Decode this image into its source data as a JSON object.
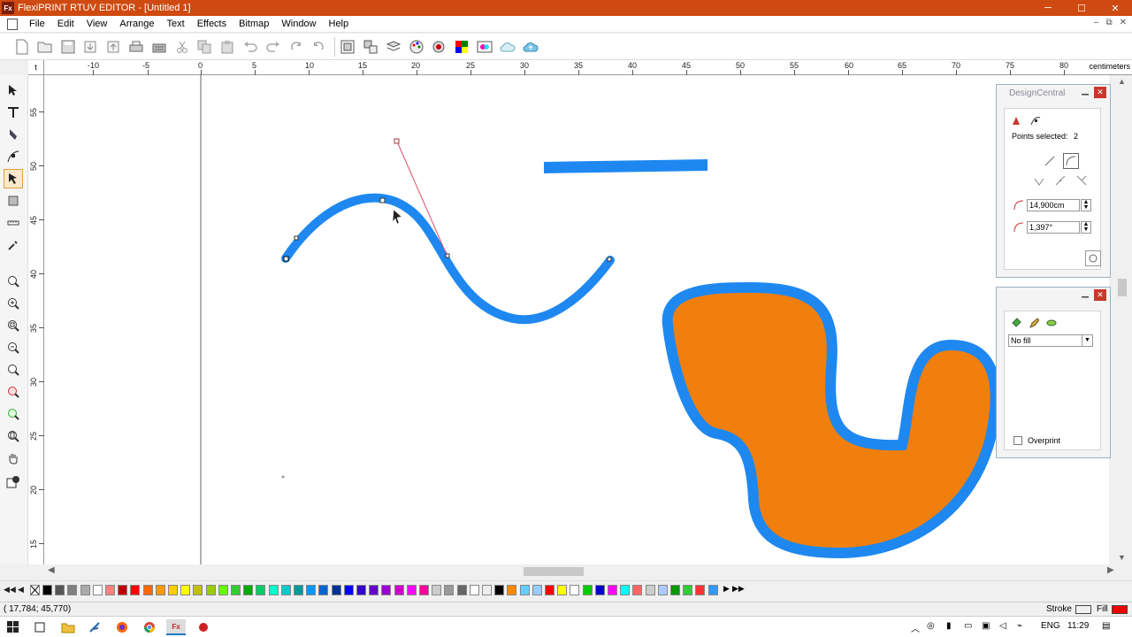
{
  "window": {
    "title": "FlexiPRINT RTUV EDITOR - [Untitled 1]",
    "app_icon": "Fx",
    "minimize": "─",
    "maximize": "☐",
    "close": "✕"
  },
  "menu": [
    "File",
    "Edit",
    "View",
    "Arrange",
    "Text",
    "Effects",
    "Bitmap",
    "Window",
    "Help"
  ],
  "mdi_controls": {
    "minimize": "–",
    "restore": "⧉",
    "close": "✕"
  },
  "toolbar_icons": [
    "new-icon",
    "open-icon",
    "save-icon",
    "import-icon",
    "export-icon",
    "print-icon",
    "print-cut-icon",
    "cut-icon",
    "copy-icon",
    "paste-icon",
    "undo-icon",
    "redo-icon",
    "repeat-icon",
    "redo-repeat-icon",
    "group-icon",
    "ungroup-icon",
    "layers-icon",
    "color-palette-icon",
    "color-picker-icon",
    "swatch-grid-icon",
    "color-manage-icon",
    "cloud-icon",
    "upload-icon"
  ],
  "ruler": {
    "unit": "centimeters",
    "h_ticks": [
      "-10",
      "-5",
      "0",
      "5",
      "10",
      "15",
      "20",
      "25",
      "30",
      "35",
      "40",
      "45",
      "50",
      "55",
      "60",
      "65",
      "70",
      "75",
      "80"
    ],
    "v_ticks": [
      "55",
      "50",
      "45",
      "40",
      "35",
      "30",
      "25",
      "20",
      "15"
    ],
    "corner": "t"
  },
  "toolbox": [
    "select-arrow-icon",
    "text-tool-icon",
    "pen-tool-icon",
    "node-edit-icon",
    "shape-edit-icon",
    "crop-icon",
    "measure-icon",
    "eyedropper-icon",
    "zoom-icon",
    "zoom-in-icon",
    "zoom-box-icon",
    "zoom-out-icon",
    "zoom-fit-icon",
    "zoom-selection-icon",
    "zoom-all-icon",
    "zoom-page-icon",
    "hand-pan-icon",
    "fill-stroke-icon"
  ],
  "design_central": {
    "title": "DesignCentral",
    "points_selected_label": "Points selected:",
    "points_selected_value": "2",
    "length_value": "14,900cm",
    "angle_value": "1,397°",
    "tab_icons": [
      "node-tab-icon",
      "curve-tab-icon"
    ],
    "node_buttons": [
      "line-node-icon",
      "curve-node-icon",
      "cusp-node-icon",
      "smooth-node-icon",
      "symmetric-node-icon"
    ]
  },
  "fill_panel": {
    "fill_value": "No fill",
    "overprint_label": "Overprint",
    "tab_icons": [
      "fill-bucket-icon",
      "pen-stroke-icon",
      "fill-effect-icon"
    ]
  },
  "status": {
    "coords": "( 17,784;   45,770)",
    "stroke_label": "Stroke",
    "fill_label": "Fill"
  },
  "taskbar": {
    "lang": "ENG",
    "time": "11:29"
  },
  "palette_colors": [
    "#000000",
    "#555555",
    "#808080",
    "#aaaaaa",
    "#ffffff",
    "#ff8080",
    "#c00000",
    "#ff0000",
    "#ff6600",
    "#ff9900",
    "#ffcc00",
    "#ffff00",
    "#c0c000",
    "#99cc00",
    "#66ff00",
    "#33cc33",
    "#00aa00",
    "#00cc66",
    "#00ffcc",
    "#00cccc",
    "#009999",
    "#0099ff",
    "#0066cc",
    "#003399",
    "#0000ff",
    "#3300cc",
    "#6600cc",
    "#9900cc",
    "#cc00cc",
    "#ff00ff",
    "#ff0099",
    "#cccccc",
    "#999999",
    "#666666",
    "#ffffff",
    "#eeeeee",
    "#000000",
    "#ff8800",
    "#66ccff",
    "#99ccff",
    "#ff0000",
    "#ffff00",
    "#ffffff",
    "#00cc00",
    "#0000cc",
    "#ff00ff",
    "#00ffff",
    "#ff6666",
    "#cccccc",
    "#aaccff",
    "#009900",
    "#33cc33",
    "#ff3333",
    "#3399ff"
  ]
}
